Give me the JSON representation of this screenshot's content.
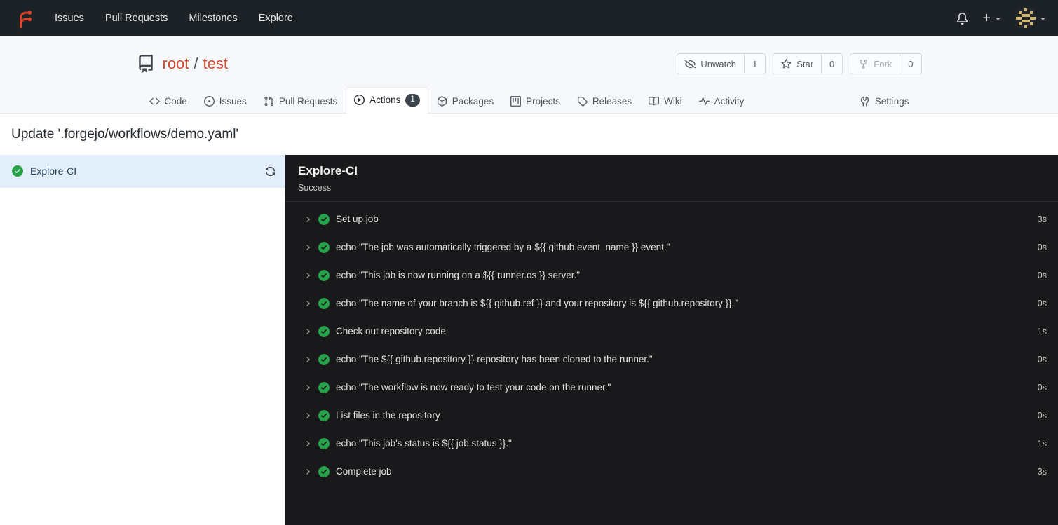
{
  "colors": {
    "brand_orange": "#e2432c",
    "success_green": "#26a148",
    "navbar_bg": "#1d2227",
    "selected_job_bg": "#e2eef9",
    "log_panel_bg": "#19191b"
  },
  "navbar": {
    "links": [
      {
        "label": "Issues"
      },
      {
        "label": "Pull Requests"
      },
      {
        "label": "Milestones"
      },
      {
        "label": "Explore"
      }
    ],
    "plus_glyph": "+"
  },
  "repo": {
    "owner": "root",
    "separator": "/",
    "name": "test",
    "actions": {
      "unwatch": {
        "label": "Unwatch",
        "count": "1"
      },
      "star": {
        "label": "Star",
        "count": "0"
      },
      "fork": {
        "label": "Fork",
        "count": "0"
      }
    },
    "tabs": [
      {
        "label": "Code"
      },
      {
        "label": "Issues"
      },
      {
        "label": "Pull Requests"
      },
      {
        "label": "Actions",
        "badge": "1",
        "active": true
      },
      {
        "label": "Packages"
      },
      {
        "label": "Projects"
      },
      {
        "label": "Releases"
      },
      {
        "label": "Wiki"
      },
      {
        "label": "Activity"
      },
      {
        "label": "Settings"
      }
    ]
  },
  "run": {
    "title": "Update '.forgejo/workflows/demo.yaml'",
    "jobs": [
      {
        "name": "Explore-CI",
        "status": "success",
        "selected": true
      }
    ],
    "panel": {
      "job_name": "Explore-CI",
      "status": "Success",
      "steps": [
        {
          "name": "Set up job",
          "duration": "3s"
        },
        {
          "name": "echo \"The job was automatically triggered by a ${{ github.event_name }} event.\"",
          "duration": "0s"
        },
        {
          "name": "echo \"This job is now running on a ${{ runner.os }} server.\"",
          "duration": "0s"
        },
        {
          "name": "echo \"The name of your branch is ${{ github.ref }} and your repository is ${{ github.repository }}.\"",
          "duration": "0s"
        },
        {
          "name": "Check out repository code",
          "duration": "1s"
        },
        {
          "name": "echo \"The ${{ github.repository }} repository has been cloned to the runner.\"",
          "duration": "0s"
        },
        {
          "name": "echo \"The workflow is now ready to test your code on the runner.\"",
          "duration": "0s"
        },
        {
          "name": "List files in the repository",
          "duration": "0s"
        },
        {
          "name": "echo \"This job's status is ${{ job.status }}.\"",
          "duration": "1s"
        },
        {
          "name": "Complete job",
          "duration": "3s"
        }
      ]
    }
  }
}
